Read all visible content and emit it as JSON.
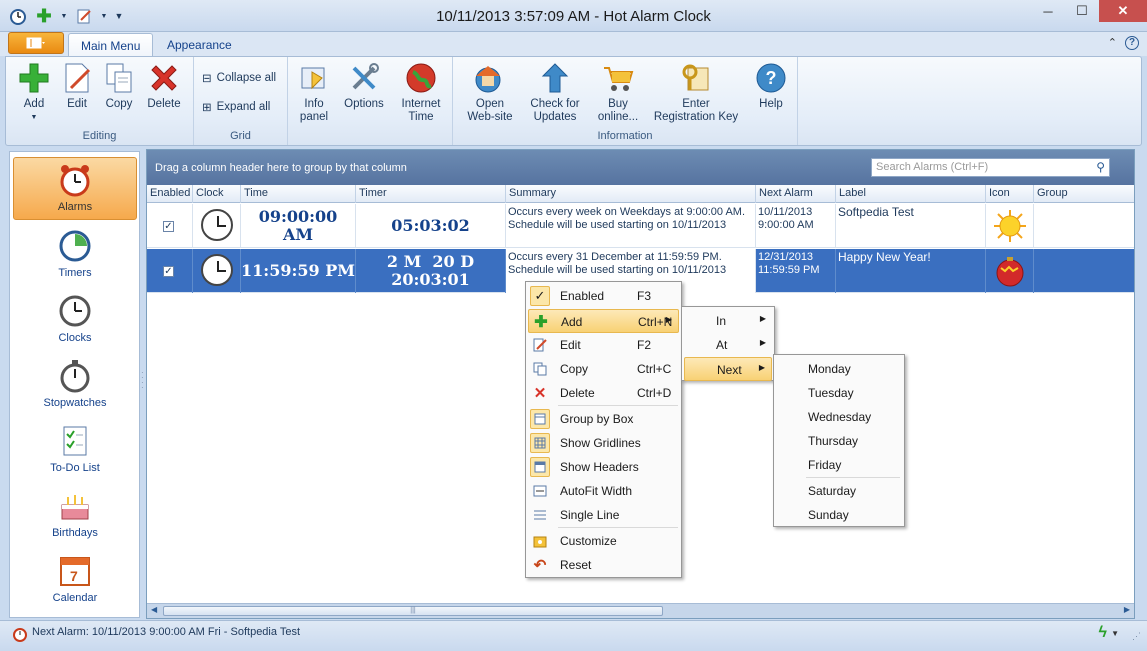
{
  "window": {
    "title": "10/11/2013 3:57:09 AM - Hot Alarm Clock"
  },
  "tabs": [
    {
      "label": "Main Menu"
    },
    {
      "label": "Appearance"
    }
  ],
  "ribbon": {
    "add": "Add",
    "edit": "Edit",
    "copy": "Copy",
    "delete": "Delete",
    "editing_group": "Editing",
    "collapse_all": "Collapse all",
    "expand_all": "Expand all",
    "grid_group": "Grid",
    "info_panel_1": "Info",
    "info_panel_2": "panel",
    "options": "Options",
    "internet_time_1": "Internet",
    "internet_time_2": "Time",
    "open_website_1": "Open",
    "open_website_2": "Web-site",
    "check_updates_1": "Check for",
    "check_updates_2": "Updates",
    "buy_online_1": "Buy",
    "buy_online_2": "online...",
    "enter_key_1": "Enter",
    "enter_key_2": "Registration Key",
    "information_group": "Information",
    "help": "Help"
  },
  "sidebar": {
    "items": [
      {
        "label": "Alarms",
        "icon": "alarm-clock-icon"
      },
      {
        "label": "Timers",
        "icon": "timer-icon"
      },
      {
        "label": "Clocks",
        "icon": "clock-icon"
      },
      {
        "label": "Stopwatches",
        "icon": "stopwatch-icon"
      },
      {
        "label": "To-Do List",
        "icon": "todo-list-icon"
      },
      {
        "label": "Birthdays",
        "icon": "birthday-cake-icon"
      },
      {
        "label": "Calendar",
        "icon": "calendar-icon"
      }
    ]
  },
  "grid": {
    "group_hint": "Drag a column header here to group by that column",
    "search_placeholder": "Search Alarms (Ctrl+F)",
    "columns": [
      "Enabled",
      "Clock",
      "Time",
      "Timer",
      "Summary",
      "Next Alarm",
      "Label",
      "Icon",
      "Group"
    ],
    "rows": [
      {
        "enabled": "✓",
        "time": "09:00:00 AM",
        "timer_line1": "05:03:02",
        "timer_line2": "",
        "summary_1": "Occurs every week on Weekdays at 9:00:00 AM.",
        "summary_2": "Schedule will be used starting on 10/11/2013",
        "next_1": "10/11/2013",
        "next_2": "9:00:00 AM",
        "label": "Softpedia Test"
      },
      {
        "enabled": "✓",
        "time": "11:59:59 PM",
        "timer_line1": "2 M  20 D",
        "timer_line2": "20:03:01",
        "summary_1": "Occurs every 31 December at 11:59:59 PM.",
        "summary_2": "Schedule will be used starting on 10/11/2013",
        "next_1": "12/31/2013",
        "next_2": "11:59:59 PM",
        "label": "Happy New Year!"
      }
    ]
  },
  "context_menu": {
    "enabled": "Enabled",
    "enabled_sc": "F3",
    "add": "Add",
    "add_sc": "Ctrl+N",
    "edit": "Edit",
    "edit_sc": "F2",
    "copy": "Copy",
    "copy_sc": "Ctrl+C",
    "delete": "Delete",
    "delete_sc": "Ctrl+D",
    "group_by_box": "Group by Box",
    "show_gridlines": "Show Gridlines",
    "show_headers": "Show Headers",
    "autofit_width": "AutoFit Width",
    "single_line": "Single Line",
    "customize": "Customize",
    "reset": "Reset"
  },
  "add_submenu": {
    "in": "In",
    "at": "At",
    "next": "Next"
  },
  "next_submenu": {
    "days": [
      "Monday",
      "Tuesday",
      "Wednesday",
      "Thursday",
      "Friday",
      "Saturday",
      "Sunday"
    ]
  },
  "status": {
    "text": "Next Alarm: 10/11/2013 9:00:00 AM Fri - Softpedia Test"
  }
}
